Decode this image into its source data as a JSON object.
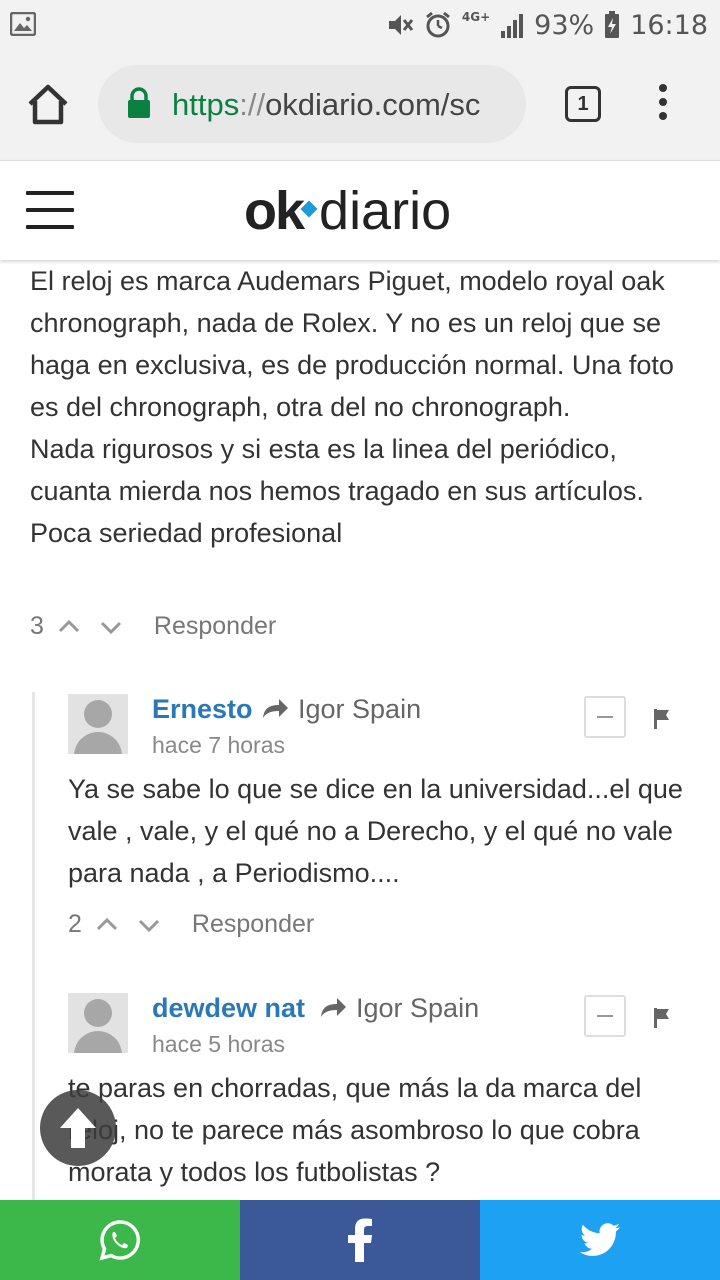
{
  "status_bar": {
    "battery": "93%",
    "time": "16:18",
    "network": "4G+",
    "icons": [
      "image-icon",
      "mute-icon",
      "alarm-icon",
      "signal-icon",
      "battery-icon"
    ]
  },
  "browser": {
    "url_scheme": "https",
    "url_sep": "://",
    "url_rest": "okdiario.com/sc",
    "tab_count": "1",
    "icons": [
      "home-icon",
      "lock-icon",
      "tab-switcher-icon",
      "overflow-menu-icon"
    ]
  },
  "site": {
    "logo_ok": "ok",
    "logo_diario": "diario",
    "brand_color": "#1e9ad6"
  },
  "top_comment": {
    "text": "El reloj es marca Audemars Piguet, modelo royal oak chronograph, nada de Rolex. Y no es un reloj que se haga en exclusiva, es de producción normal. Una foto es del chronograph, otra del no chronograph.\nNada rigurosos y si esta es la linea del periódico, cuanta mierda nos hemos tragado en sus artículos. Poca seriedad profesional",
    "votes": "3",
    "reply_label": "Responder"
  },
  "replies": [
    {
      "author": "Ernesto",
      "parent": "Igor Spain",
      "time": "hace 7 horas",
      "text": "Ya se sabe lo que se dice en la universidad...el que vale , vale, y el qué no a Derecho, y el qué no vale para nada , a Periodismo....",
      "votes": "2",
      "reply_label": "Responder"
    },
    {
      "author": "dewdew nat",
      "parent": "Igor Spain",
      "time": "hace 5 horas",
      "text": "te paras en chorradas, que más la da marca del reloj, no te parece más asombroso lo que cobra morata y todos los futbolistas ?"
    }
  ],
  "share_bar": {
    "whatsapp_color": "#3cb84a",
    "facebook_color": "#3b5998",
    "twitter_color": "#1da1f2",
    "icons": [
      "whatsapp-icon",
      "facebook-icon",
      "twitter-icon"
    ]
  }
}
